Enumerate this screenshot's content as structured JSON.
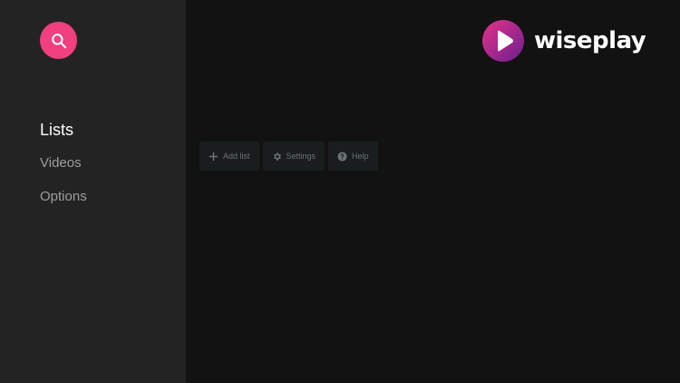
{
  "brand": {
    "name": "wiseplay",
    "logo_gradient": [
      "#e6338a",
      "#6a1f8e"
    ]
  },
  "sidebar": {
    "search_icon": "search-icon",
    "items": [
      {
        "label": "Lists",
        "active": true
      },
      {
        "label": "Videos",
        "active": false
      },
      {
        "label": "Options",
        "active": false
      }
    ]
  },
  "toolbar": {
    "buttons": [
      {
        "label": "Add list",
        "icon": "plus-icon"
      },
      {
        "label": "Settings",
        "icon": "gear-icon"
      },
      {
        "label": "Help",
        "icon": "help-icon"
      }
    ]
  },
  "colors": {
    "accent": "#f0407e",
    "sidebar_bg": "#232323",
    "main_bg": "#121212",
    "active_text": "#ffffff",
    "inactive_text": "#9e9e9e"
  }
}
